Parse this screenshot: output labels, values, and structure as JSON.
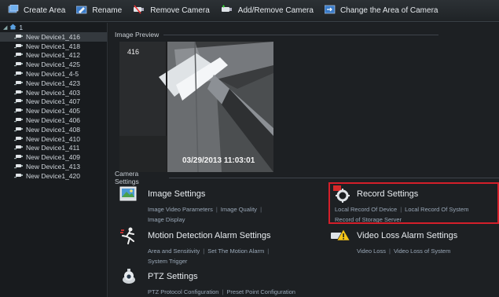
{
  "toolbar": {
    "create_area": "Create Area",
    "rename": "Rename",
    "remove_camera": "Remove Camera",
    "add_remove_camera": "Add/Remove Camera",
    "change_area": "Change the Area of Camera"
  },
  "tree": {
    "root_label": "1",
    "devices": [
      "New Device1_416",
      "New Device1_418",
      "New Device1_412",
      "New Device1_425",
      "New Device1_4-5",
      "New Device1_423",
      "New Device1_403",
      "New Device1_407",
      "New Device1_405",
      "New Device1_406",
      "New Device1_408",
      "New Device1_410",
      "New Device1_411",
      "New Device1_409",
      "New Device1_413",
      "New Device1_420"
    ]
  },
  "preview": {
    "section_title": "Image Preview",
    "camera_label": "416",
    "timestamp": "03/29/2013 11:03:01"
  },
  "camera_settings": {
    "section_title": "Camera Settings",
    "image": {
      "title": "Image Settings",
      "links": [
        "Image Video Parameters",
        "Image Quality",
        "Image Display"
      ]
    },
    "record": {
      "title": "Record Settings",
      "links": [
        "Local Record Of Device",
        "Local Record Of System",
        "Record of Storage Server"
      ]
    },
    "motion": {
      "title": "Motion Detection Alarm Settings",
      "links": [
        "Area and Sensitivity",
        "Set The Motion Alarm",
        "System Trigger"
      ]
    },
    "video_loss": {
      "title": "Video Loss Alarm Settings",
      "links": [
        "Video Loss",
        "Video Loss of System"
      ]
    },
    "ptz": {
      "title": "PTZ Settings",
      "links": [
        "PTZ Protocol Configuration",
        "Preset Point Configuration"
      ]
    }
  },
  "colors": {
    "highlight": "#d41f2a",
    "link": "#9aa8b8"
  }
}
